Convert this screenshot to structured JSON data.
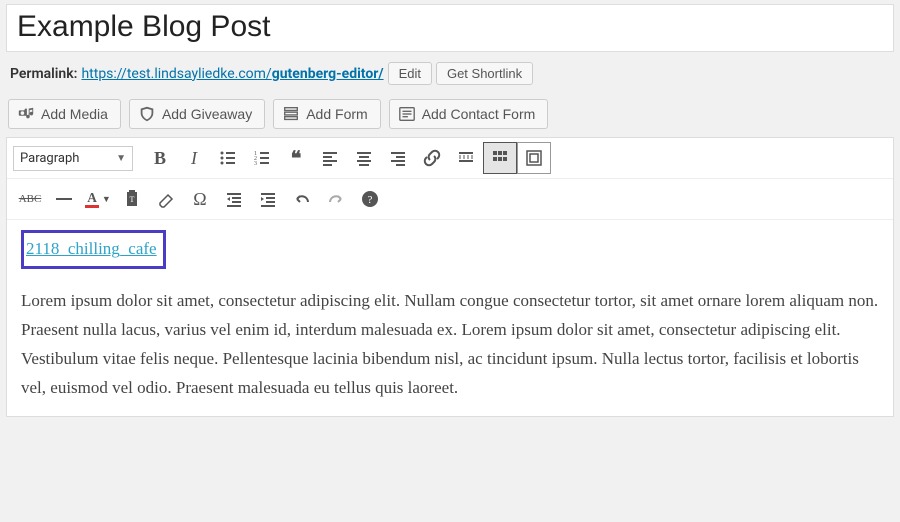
{
  "title": "Example Blog Post",
  "permalink": {
    "label": "Permalink:",
    "url_base": "https://test.lindsayliedke.com/",
    "slug": "gutenberg-editor/",
    "edit_label": "Edit",
    "shortlink_label": "Get Shortlink"
  },
  "media_buttons": {
    "add_media": "Add Media",
    "add_giveaway": "Add Giveaway",
    "add_form": "Add Form",
    "add_contact_form": "Add Contact Form"
  },
  "toolbar": {
    "format": "Paragraph"
  },
  "content": {
    "link_text": "2118_chilling_cafe",
    "paragraph": "Lorem ipsum dolor sit amet, consectetur adipiscing elit. Nullam congue consectetur tortor, sit amet ornare lorem aliquam non. Praesent nulla lacus, varius vel enim id, interdum malesuada ex. Lorem ipsum dolor sit amet, consectetur adipiscing elit. Vestibulum vitae felis neque. Pellentesque lacinia bibendum nisl, ac tincidunt ipsum. Nulla lectus tortor, facilisis et lobortis vel, euismod vel odio. Praesent malesuada eu tellus quis laoreet."
  }
}
